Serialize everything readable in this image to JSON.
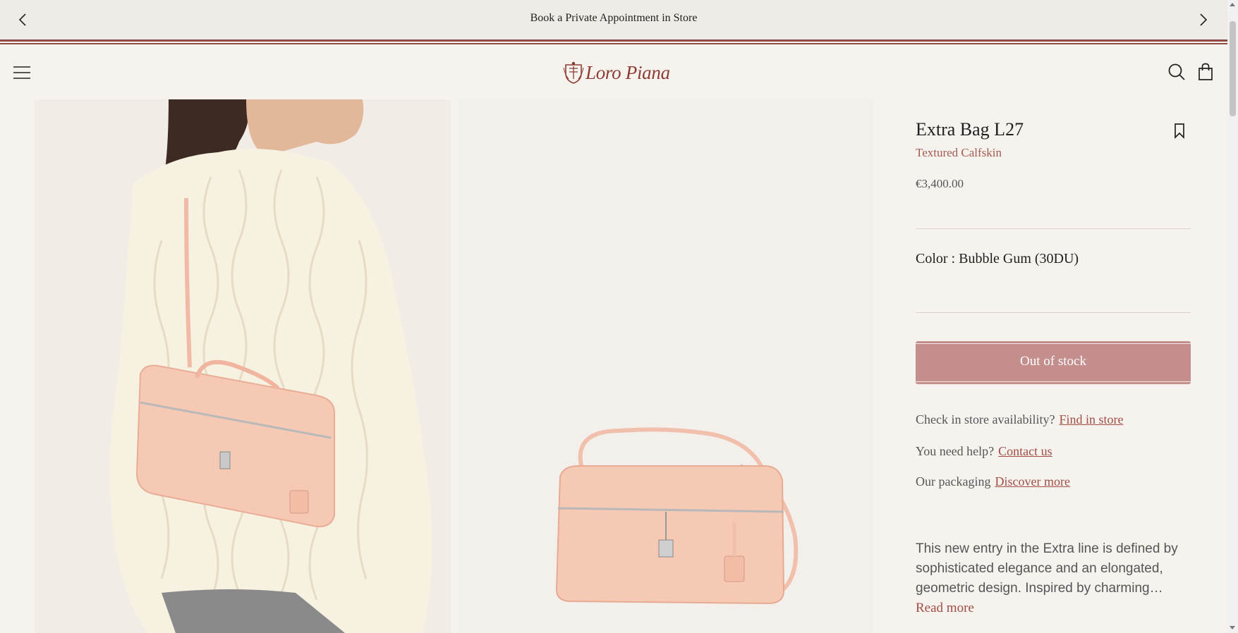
{
  "promo": {
    "text": "Book a Private Appointment in Store",
    "prev_icon": "chevron-left-icon",
    "next_icon": "chevron-right-icon"
  },
  "header": {
    "menu_icon": "hamburger-menu-icon",
    "logo_text": "Loro Piana",
    "search_icon": "search-icon",
    "bag_icon": "shopping-bag-icon"
  },
  "product": {
    "title": "Extra Bag L27",
    "material": "Textured Calfskin",
    "price": "€3,400.00",
    "color_label": "Color : Bubble Gum (30DU)",
    "stock_button": "Out of stock",
    "bookmark_icon": "bookmark-icon",
    "store_availability_label": "Check in store availability?",
    "store_availability_link": "Find in store",
    "help_label": "You need help?",
    "help_link": "Contact us",
    "packaging_label": "Our packaging",
    "packaging_link": "Discover more",
    "description": "This new entry in the Extra line is defined by sophisticated elegance and an elongated, geometric design. Inspired by charming…",
    "read_more": "Read more"
  },
  "colors": {
    "accent": "#8d3c34",
    "button": "#c38e8c",
    "bag": "#f6c9b5",
    "sweater": "#f7f1e1"
  }
}
